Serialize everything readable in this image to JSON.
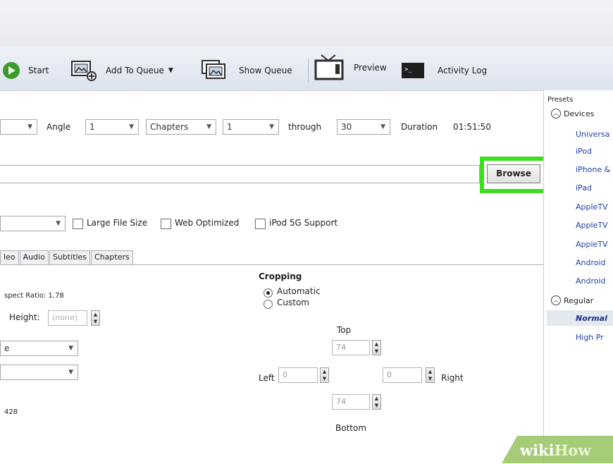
{
  "toolbar": {
    "start_label": "Start",
    "add_queue_label": "Add To Queue",
    "show_queue_label": "Show Queue",
    "preview_label": "Preview",
    "activity_log_label": "Activity Log"
  },
  "source": {
    "angle_label": "Angle",
    "angle_value": "1",
    "range_type": "Chapters",
    "from_value": "1",
    "through_label": "through",
    "to_value": "30",
    "duration_label": "Duration",
    "duration_value": "01:51:50"
  },
  "destination": {
    "browse_label": "Browse",
    "highlight_color": "#3fdd1f"
  },
  "output": {
    "large_file_label": "Large File Size",
    "web_optimized_label": "Web Optimized",
    "ipod_label": "iPod 5G Support"
  },
  "tabs": [
    "leo",
    "Audio",
    "Subtitles",
    "Chapters"
  ],
  "picture": {
    "aspect_ratio_text": "spect Ratio: 1.78",
    "height_label": "Height:",
    "height_placeholder": "(none)",
    "combo1_value": "e",
    "size_text": "428"
  },
  "cropping": {
    "title": "Cropping",
    "automatic_label": "Automatic",
    "custom_label": "Custom",
    "top_label": "Top",
    "top_value": "74",
    "left_label": "Left",
    "left_value": "0",
    "right_value": "0",
    "right_label": "Right",
    "bottom_value": "74",
    "bottom_label": "Bottom"
  },
  "presets": {
    "title": "Presets",
    "devices_label": "Devices",
    "device_items": [
      "Universa",
      "iPod",
      "iPhone &",
      "iPad",
      "AppleTV",
      "AppleTV",
      "AppleTV",
      "Android",
      "Android"
    ],
    "regular_label": "Regular",
    "regular_items": [
      "Normal",
      "High Pr"
    ]
  },
  "watermark": {
    "part1": "wiki",
    "part2": "How"
  }
}
